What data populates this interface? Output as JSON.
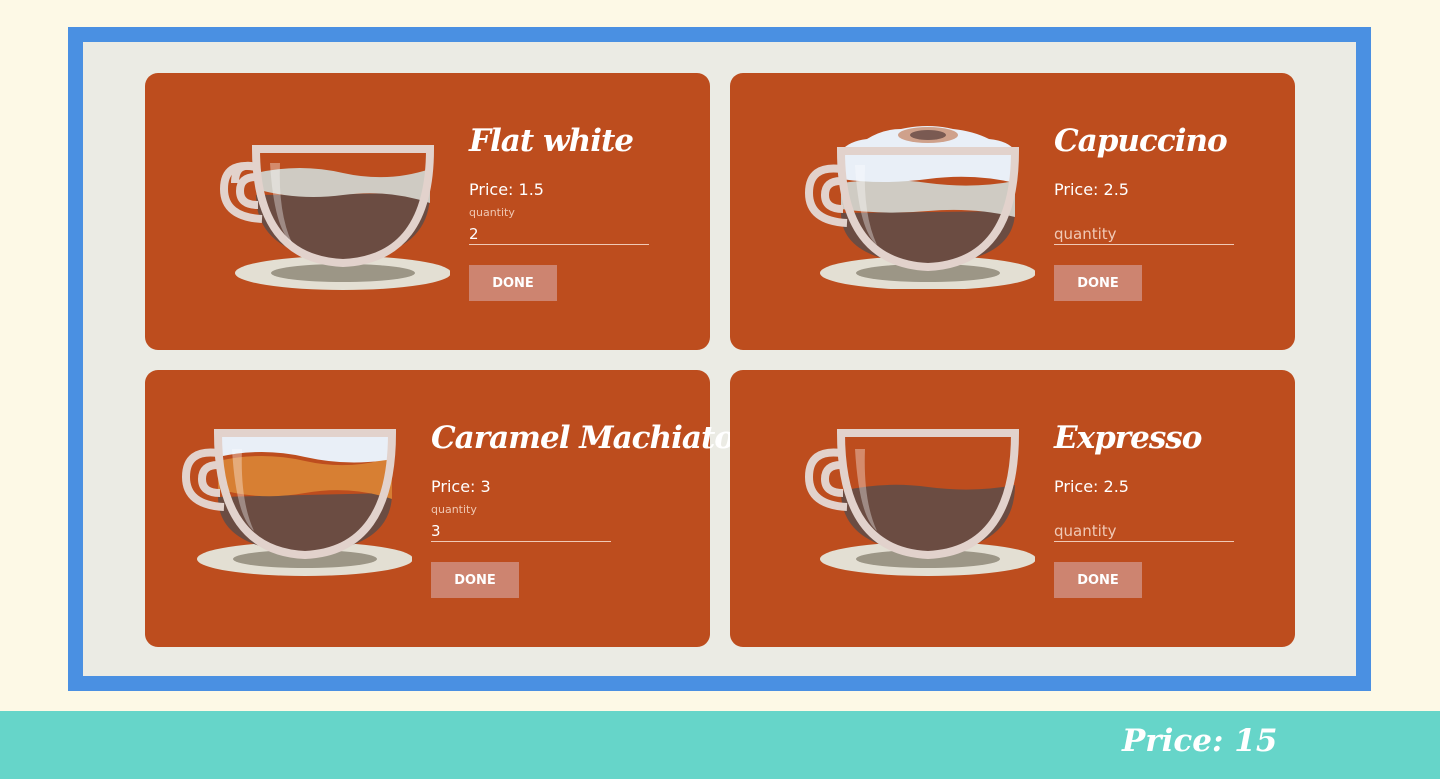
{
  "products": [
    {
      "name": "Flat white",
      "price_label": "Price: 1.5",
      "quantity_label": "quantity",
      "quantity_value": "2",
      "quantity_placeholder": "",
      "button_label": "DONE",
      "cup_style": "flat-white"
    },
    {
      "name": "Capuccino",
      "price_label": "Price: 2.5",
      "quantity_label": "",
      "quantity_value": "",
      "quantity_placeholder": "quantity",
      "button_label": "DONE",
      "cup_style": "cappuccino"
    },
    {
      "name": "Caramel Machiato",
      "price_label": "Price: 3",
      "quantity_label": "quantity",
      "quantity_value": "3",
      "quantity_placeholder": "",
      "button_label": "DONE",
      "cup_style": "caramel-macchiato"
    },
    {
      "name": "Expresso",
      "price_label": "Price: 2.5",
      "quantity_label": "",
      "quantity_value": "",
      "quantity_placeholder": "quantity",
      "button_label": "DONE",
      "cup_style": "espresso"
    }
  ],
  "footer": {
    "total_label": "Price: 15"
  },
  "colors": {
    "page_background": "#fdf9e6",
    "frame_border": "#4a90e2",
    "frame_fill": "#ebebe4",
    "card": "#bd4d1e",
    "button": "#cd8470",
    "footer": "#66d5c9",
    "coffee": "#6b4c42",
    "caramel": "#d77f33",
    "milk": "#cfcbc3",
    "foam": "#e9eff7"
  }
}
